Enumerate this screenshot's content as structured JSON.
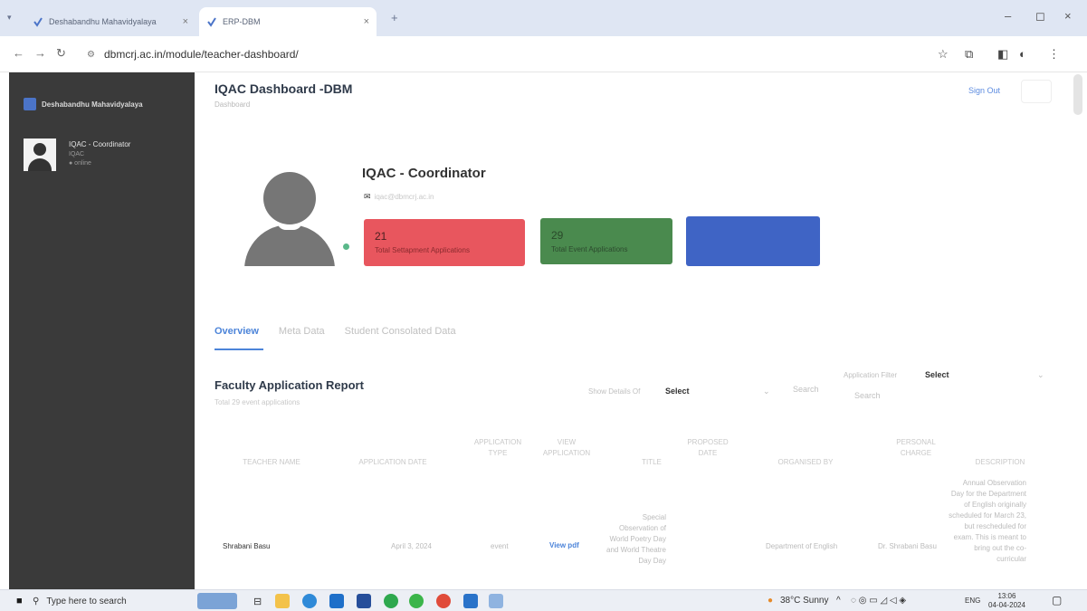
{
  "browser": {
    "tabs": [
      {
        "title": "Deshabandhu Mahavidyalaya"
      },
      {
        "title": "ERP-DBM"
      }
    ],
    "url": "dbmcrj.ac.in/module/teacher-dashboard/"
  },
  "sidebar": {
    "brand": "Deshabandhu Mahavidyalaya",
    "user": {
      "name": "IQAC - Coordinator",
      "role": "IQAC",
      "status": "● online"
    }
  },
  "header": {
    "title": "IQAC Dashboard -DBM",
    "breadcrumb": "Dashboard",
    "signout": "Sign Out"
  },
  "profile": {
    "name": "IQAC - Coordinator",
    "email": "iqac@dbmcrj.ac.in"
  },
  "stats": [
    {
      "value": "21",
      "label": "Total Settapment Applications",
      "color": "#e8565e"
    },
    {
      "value": "29",
      "label": "Total Event Applications",
      "color": "#4a8a4e"
    },
    {
      "value": "",
      "label": "",
      "color": "#3f64c5"
    }
  ],
  "tabs": [
    "Overview",
    "Meta Data",
    "Student Consolated Data"
  ],
  "report": {
    "title": "Faculty Application Report",
    "subtitle": "Total 29 event applications",
    "show_details_label": "Show Details Of",
    "show_details_value": "Select",
    "search_label": "Search",
    "app_filter_label": "Application Filter",
    "app_filter_value": "Select",
    "search2_label": "Search",
    "columns": [
      "TEACHER NAME",
      "APPLICATION DATE",
      "APPLICATION TYPE",
      "VIEW APPLICATION",
      "TITLE",
      "PROPOSED DATE",
      "ORGANISED BY",
      "PERSONAL CHARGE",
      "DESCRIPTION"
    ],
    "rows": [
      {
        "teacher": "Shrabani Basu",
        "date": "April 3, 2024",
        "type": "event",
        "view": "View pdf",
        "title": "Special Observation of World Poetry Day and World Theatre Day Day",
        "organised_by": "Department of English",
        "charge": "Dr. Shrabani Basu",
        "description": "Annual Observation Day for the Department of English originally scheduled for March 23, but rescheduled for exam. This is meant to bring out the co-curricular"
      }
    ]
  },
  "taskbar": {
    "search_placeholder": "Type here to search",
    "weather": "38°C Sunny",
    "lang": "ENG",
    "time": "13:06",
    "date": "04-04-2024"
  }
}
